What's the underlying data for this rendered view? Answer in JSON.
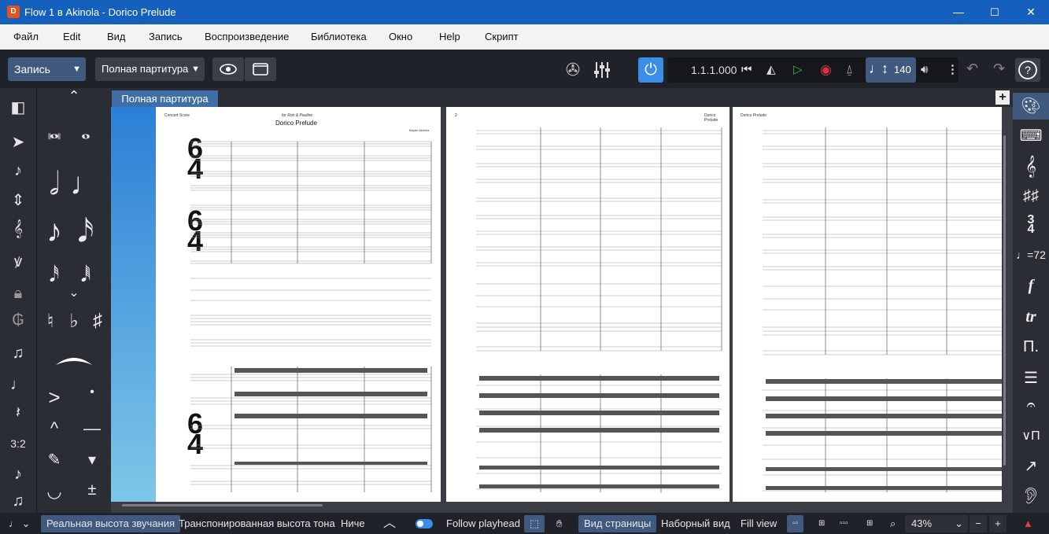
{
  "window": {
    "title": "Flow 1 в Akinola - Dorico Prelude",
    "app_icon_letter": "D",
    "minimize": "—",
    "maximize": "☐",
    "close": "✕"
  },
  "menu": [
    "Файл",
    "Edit",
    "Вид",
    "Запись",
    "Воспроизведение",
    "Библиотека",
    "Окно",
    "Help",
    "Скрипт"
  ],
  "toolbar": {
    "mode": "Запись",
    "layout": "Полная партитура",
    "position": "1.1.1.000",
    "tempo": "140"
  },
  "tab": {
    "label": "Полная партитура",
    "add": "+"
  },
  "score": {
    "page1_header_left": "Concert Score",
    "page1_dedication": "for Ron & Pauline",
    "page1_title": "Dorico Prelude",
    "page1_composer": "Bayan Akinola",
    "page2_number": "2",
    "page2_header": "Dorico Prelude",
    "page3_header": "Dorico Prelude",
    "time_signature_top": "6",
    "time_signature_bottom": "4"
  },
  "left_panel": {
    "tuplet_label": "3:2"
  },
  "statusbar": {
    "concert_pitch": "Реальная высота звучания",
    "transposed_pitch": "Транспонированная высота тона",
    "truncated": "Ниче",
    "follow_playhead": "Follow playhead",
    "page_view": "Вид страницы",
    "galley_view": "Наборный вид",
    "fill_view": "Fill view",
    "zoom": "43%",
    "zoom_out": "−",
    "zoom_in": "+"
  },
  "colors": {
    "titlebar": "#1560bd",
    "accent": "#3a8ee6",
    "play": "#2fb344",
    "record": "#d9333f",
    "warning": "#e04040"
  }
}
